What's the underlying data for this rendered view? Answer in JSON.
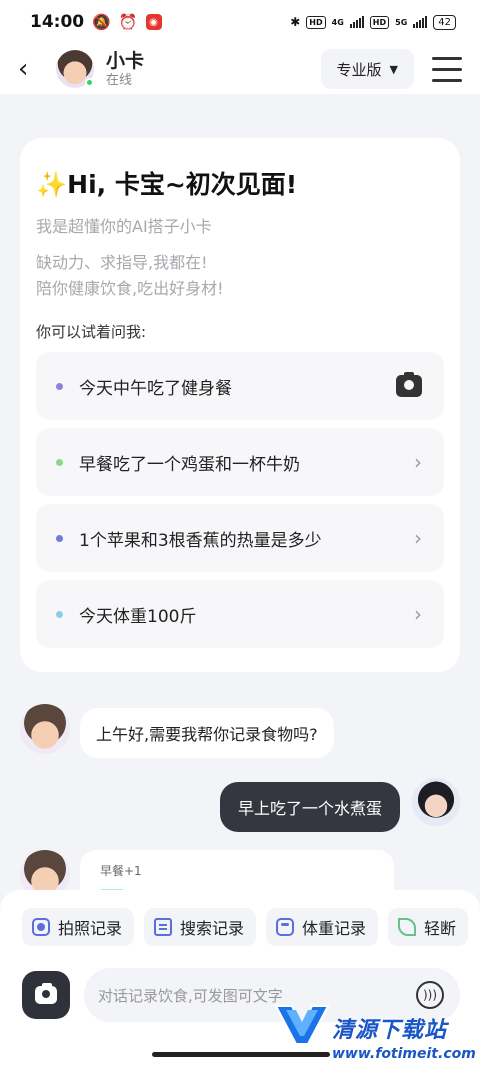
{
  "status_bar": {
    "time": "14:00",
    "battery": "42",
    "network_1": "4G",
    "network_2": "5G",
    "hd_label": "HD"
  },
  "header": {
    "name": "小卡",
    "status": "在线",
    "plan_label": "专业版"
  },
  "welcome": {
    "title_emoji": "✨",
    "title": "Hi, 卡宝~初次见面!",
    "subtitle": "我是超懂你的AI搭子小卡",
    "desc_line1": "缺动力、求指导,我都在!",
    "desc_line2": "陪你健康饮食,吃出好身材!",
    "prompt": "你可以试着问我:",
    "suggestions": [
      {
        "label": "今天中午吃了健身餐",
        "dot_color": "#8b83d8",
        "icon": "camera-icon"
      },
      {
        "label": "早餐吃了一个鸡蛋和一杯牛奶",
        "dot_color": "#8fd68a",
        "icon": "chevron-right-icon"
      },
      {
        "label": "1个苹果和3根香蕉的热量是多少",
        "dot_color": "#6f7bd4",
        "icon": "chevron-right-icon"
      },
      {
        "label": "今天体重100斤",
        "dot_color": "#8ecbe8",
        "icon": "chevron-right-icon"
      }
    ]
  },
  "chat": {
    "bot_message": "上午好,需要我帮你记录食物吗?",
    "user_message": "早上吃了一个水煮蛋",
    "record_tag": "早餐+1"
  },
  "quick_actions": [
    {
      "label": "拍照记录",
      "icon": "camera-record-icon"
    },
    {
      "label": "搜索记录",
      "icon": "search-record-icon"
    },
    {
      "label": "体重记录",
      "icon": "scale-icon"
    },
    {
      "label": "轻断",
      "icon": "leaf-icon"
    }
  ],
  "input": {
    "placeholder": "对话记录饮食,可发图可文字"
  },
  "watermark": {
    "title": "清源下载站",
    "url": "www.fotimeit.com"
  },
  "colors": {
    "accent": "#5b6ee0",
    "dark_bubble": "#34373f",
    "background": "#f3f4f8"
  }
}
